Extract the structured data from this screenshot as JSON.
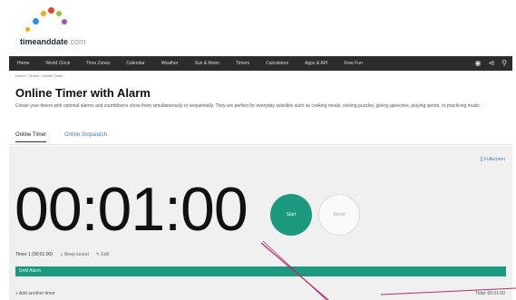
{
  "brand": {
    "name": "timeanddate",
    "tld": ".com"
  },
  "nav": {
    "items": [
      "Home",
      "World Clock",
      "Time Zones",
      "Calendar",
      "Weather",
      "Sun & Moon",
      "Timers",
      "Calculators",
      "Apps & API",
      "Free Fun"
    ],
    "icons": [
      "user-icon",
      "share-icon",
      "search-icon"
    ]
  },
  "breadcrumb": "Home › Timers › Online Timer",
  "page": {
    "title": "Online Timer with Alarm",
    "description": "Create your timers with optional alarms and countdowns show them simultaneously or sequentially. They are perfect for everyday activities such as cooking meals, solving puzzles, giving speeches, playing sports, or practicing music."
  },
  "tabs": [
    "Online Timer",
    "Online Stopwatch"
  ],
  "timer": {
    "fullscreen_label": "[] Fullscreen",
    "display": "00:01:00",
    "start_label": "Start",
    "reset_label": "Reset",
    "name": "Timer 1 (00:01:00)",
    "sound_label": "Beep sound",
    "edit_label": "Edit",
    "bar_label": "Until Alarm",
    "progress": 1.0,
    "add_label": "+ Add another timer",
    "total_label": "Total: 00:01:00"
  },
  "colors": {
    "accent": "#1b9a7f",
    "nav_bg": "#2c2c2c",
    "annotation": "#b0306e"
  }
}
